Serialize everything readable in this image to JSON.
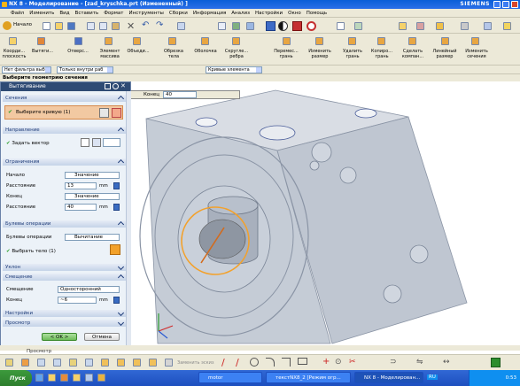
{
  "window": {
    "title": "NX 8 - Моделирование - [zad_kryschka.prt (Измененный) ]",
    "brand": "SIEMENS"
  },
  "menu": [
    "Файл",
    "Изменить",
    "Вид",
    "Вставить",
    "Формат",
    "Инструменты",
    "Сборки",
    "Информация",
    "Анализ",
    "Настройки",
    "Окно",
    "Помощь"
  ],
  "toolbar1": {
    "start_label": "Начало"
  },
  "toolbar2": {
    "left_items": [
      "Коорди...\nплоскость",
      "Вытяги...",
      "Отверс...",
      "Элемент\nмассива",
      "Объеди...",
      "Обрезка\nтела",
      "Оболочка",
      "Скругле...\nребра"
    ],
    "right_items": [
      "Перемес...\nгрань",
      "Изменить\nразмер",
      "Удалить\nгрань",
      "Копиро...\nгрань",
      "Сделать\nкомпан...",
      "Линейный\nразмер",
      "Изменить\nсечения"
    ]
  },
  "filterbar": {
    "filter_value": "Нет фильтра выб",
    "scope_value": "Только внутри раб",
    "curve_rule": "Кривые элемента"
  },
  "hint": "Выберите геометрию сечения",
  "dialog": {
    "title": "Вытягивание",
    "section": {
      "header": "Сечения",
      "select_label": "Выберите кривую (1)"
    },
    "direction": {
      "header": "Направление",
      "vector_label": "Задать вектор"
    },
    "limits": {
      "header": "Ограничения",
      "start_label": "Начало",
      "start_mode": "Значение",
      "start_distance_label": "Расстояние",
      "start_distance": "13",
      "start_unit": "mm",
      "end_label": "Конец",
      "end_mode": "Значение",
      "end_distance_label": "Расстояние",
      "end_distance": "40",
      "end_unit": "mm"
    },
    "boolean": {
      "header": "Булевы операции",
      "op_label": "Булевы операции",
      "op_value": "Вычитание",
      "select_body": "Выбрать тело (1)"
    },
    "draft": {
      "header": "Уклон"
    },
    "offset": {
      "header": "Смещение",
      "offset_label": "Смещение",
      "offset_value": "Односторонний",
      "end_label": "Конец",
      "end_value": "~6",
      "end_unit": "mm"
    },
    "settings": {
      "header": "Настройки"
    },
    "preview": {
      "header": "Просмотр"
    },
    "ok": "< OK >",
    "cancel": "Отмена"
  },
  "floating": {
    "label": "Конец",
    "value": "40"
  },
  "status_strip": "Просмотр",
  "bottombar": {
    "label": "Заменить эскиз"
  },
  "taskbar": {
    "start": "Пуск",
    "items": [
      "motor",
      "текстNX8_2 [Режим огр...",
      "NX 8 - Моделирован..."
    ],
    "lang": "RU",
    "clock": "0:53"
  }
}
